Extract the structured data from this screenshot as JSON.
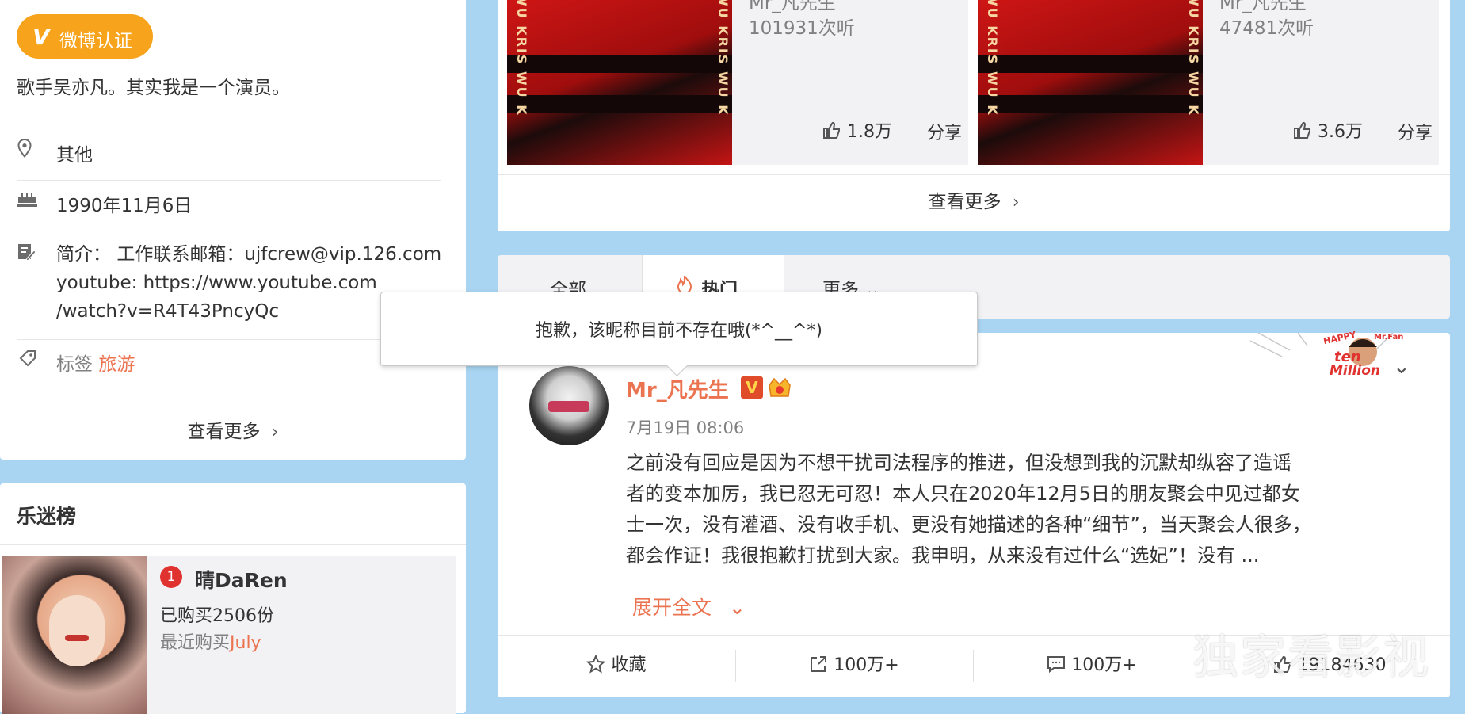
{
  "profile": {
    "verify_badge": "微博认证",
    "verify_v": "V",
    "bio": "歌手吴亦凡。其实我是一个演员。",
    "location": "其他",
    "birthday": "1990年11月6日",
    "intro_label": "简介：",
    "intro_line1": "工作联系邮箱：ujfcrew@vip.126.com",
    "intro_line2": "youtube: https://www.youtube.com",
    "intro_line3": "/watch?v=R4T43PncyQc",
    "tags_label": "标签",
    "tag_value": "旅游",
    "see_more": "查看更多",
    "icons": [
      "location-icon",
      "birthday-cake-icon",
      "edit-intro-icon",
      "tag-icon",
      "chevron-right-icon"
    ]
  },
  "fan_chart": {
    "title": "乐迷榜",
    "rank": "1",
    "name": "晴DaRen",
    "bought": "已购买2506份",
    "recent_prefix": "最近购买",
    "recent_item": "July"
  },
  "music": {
    "songs": [
      {
        "artist": "Mr_凡先生",
        "plays": "101931次听",
        "likes": "1.8万",
        "share": "分享",
        "cover_text": "WU KRIS WU K"
      },
      {
        "artist": "Mr_凡先生",
        "plays": "47481次听",
        "likes": "3.6万",
        "share": "分享",
        "cover_text": "WU KRIS WU K"
      }
    ],
    "see_more": "查看更多"
  },
  "tabs": {
    "all": "全部",
    "hot": "热门",
    "more": "更多"
  },
  "tooltip": {
    "text": "抱歉，该昵称目前不存在哦(*^__^*)"
  },
  "post": {
    "author": "Mr_凡先生",
    "v_badge": "V",
    "time": "7月19日 08:06",
    "line1": "之前没有回应是因为不想干扰司法程序的推进，但没想到我的沉默却纵容了造谣",
    "line2": "者的变本加厉，我已忍无可忍！本人只在2020年12月5日的朋友聚会中见过都女",
    "line3": "士一次，没有灌酒、没有收手机、更没有她描述的各种“细节”，当天聚会人很多，",
    "line4": "都会作证！我很抱歉打扰到大家。我申明，从来没有过什么“选妃”！没有 ...",
    "expand": "展开全文",
    "sticker_line1": "HAPPY",
    "sticker_line2": "ten",
    "sticker_line3": "Million",
    "sticker_name": "Mr.Fan",
    "actions": {
      "favorite": "收藏",
      "repost": "100万+",
      "comment": "100万+",
      "like": "19184630"
    }
  },
  "watermark": "独家看影视",
  "colors": {
    "accent": "#eb7350",
    "badge": "#f7a31c",
    "background": "#a9d5f2"
  }
}
